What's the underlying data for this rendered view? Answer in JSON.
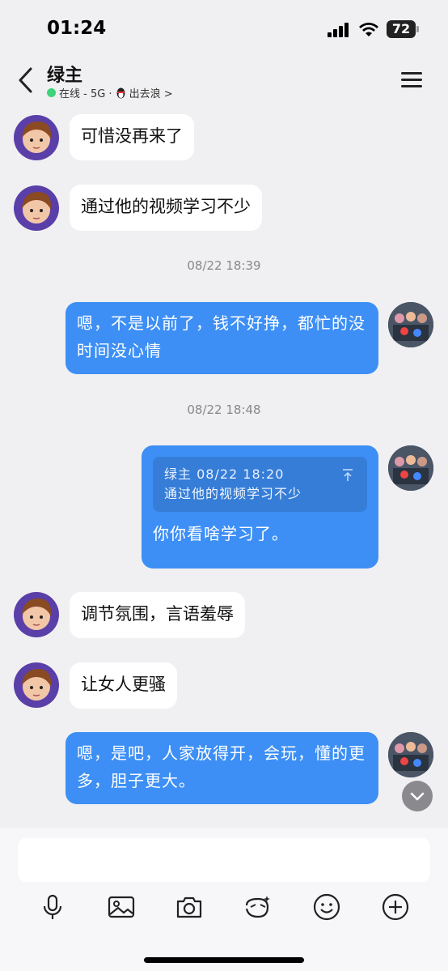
{
  "status": {
    "time": "01:24",
    "battery": "72"
  },
  "header": {
    "title": "绿主",
    "status": "在线 - 5G ·",
    "activity": "出去浪 >"
  },
  "messages": [
    {
      "side": "in",
      "text": "可惜没再来了"
    },
    {
      "side": "in",
      "text": "通过他的视频学习不少"
    },
    {
      "timestamp": "08/22 18:39"
    },
    {
      "side": "out",
      "text": "嗯，不是以前了，钱不好挣，都忙的没时间没心情"
    },
    {
      "timestamp": "08/22 18:48"
    },
    {
      "side": "out",
      "quote_head": "绿主 08/22 18:20",
      "quote_body": "通过他的视频学习不少",
      "text": "你你看啥学习了。"
    },
    {
      "side": "in",
      "text": "调节氛围，言语羞辱"
    },
    {
      "side": "in",
      "text": "让女人更骚"
    },
    {
      "side": "out",
      "text": "嗯，是吧，人家放得开，会玩，懂的更多，胆子更大。"
    }
  ],
  "input": {
    "placeholder": ""
  },
  "tools": [
    "microphone-icon",
    "image-icon",
    "camera-icon",
    "sticker-icon",
    "emoji-icon",
    "plus-icon"
  ],
  "colors": {
    "bubble_out": "#3d8ff5",
    "bubble_in": "#ffffff",
    "online": "#3ed37a"
  }
}
